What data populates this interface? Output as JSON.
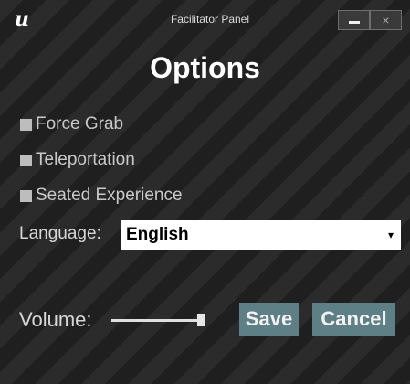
{
  "window": {
    "logo_text": "u",
    "title": "Facilitator Panel",
    "minimize_icon": "minimize-icon",
    "close_label": "×"
  },
  "heading": "Options",
  "options": [
    {
      "label": "Force Grab",
      "checked": false
    },
    {
      "label": "Teleportation",
      "checked": false
    },
    {
      "label": "Seated Experience",
      "checked": false
    }
  ],
  "language": {
    "label": "Language:",
    "selected": "English",
    "caret": "▾"
  },
  "volume": {
    "label": "Volume:",
    "level": 1.0
  },
  "buttons": {
    "save": "Save",
    "cancel": "Cancel"
  },
  "colors": {
    "button_bg": "#5f7f86",
    "checkbox": "#bdbdbd",
    "text": "#c9c9c9"
  }
}
